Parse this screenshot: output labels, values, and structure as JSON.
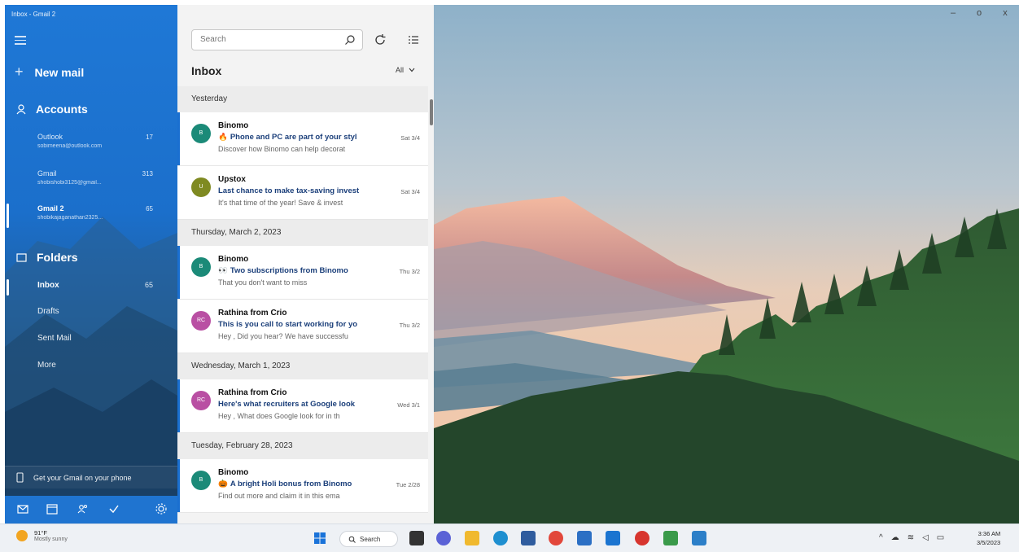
{
  "window": {
    "title": "Inbox - Gmail 2",
    "minimize": "–",
    "maximize": "o",
    "close": "x"
  },
  "sidebar": {
    "new_mail": "New mail",
    "accounts_label": "Accounts",
    "accounts": [
      {
        "name": "Outlook",
        "email": "sobimeena@outlook.com",
        "count": "17"
      },
      {
        "name": "Gmail",
        "email": "shobishobi3125@gmail...",
        "count": "313"
      },
      {
        "name": "Gmail 2",
        "email": "shobikajaganathan2325...",
        "count": "65"
      }
    ],
    "folders_label": "Folders",
    "folders": [
      {
        "label": "Inbox",
        "count": "65"
      },
      {
        "label": "Drafts",
        "count": ""
      },
      {
        "label": "Sent Mail",
        "count": ""
      },
      {
        "label": "More",
        "count": ""
      }
    ],
    "get_phone": "Get your Gmail on your phone"
  },
  "list": {
    "search_placeholder": "Search",
    "title": "Inbox",
    "filter": "All",
    "groups": [
      {
        "header": "Yesterday",
        "messages": [
          {
            "initials": "B",
            "color": "#1b8a78",
            "sender": "Binomo",
            "emoji": "🔥",
            "subject": "Phone and PC are part of your styl",
            "date": "Sat 3/4",
            "preview": "Discover how Binomo can help decorat"
          },
          {
            "initials": "U",
            "color": "#7f8a22",
            "sender": "Upstox",
            "emoji": "",
            "subject": "Last chance to make tax-saving invest",
            "date": "Sat 3/4",
            "preview": "It's that time of the year! Save & invest"
          }
        ]
      },
      {
        "header": "Thursday, March 2, 2023",
        "messages": [
          {
            "initials": "B",
            "color": "#1b8a78",
            "sender": "Binomo",
            "emoji": "👀",
            "subject": "Two subscriptions from Binomo",
            "date": "Thu 3/2",
            "preview": "That you don't want to miss"
          },
          {
            "initials": "RC",
            "color": "#b94fa3",
            "sender": "Rathina from Crio",
            "emoji": "",
            "subject": "This is you call to start working for yo",
            "date": "Thu 3/2",
            "preview": "Hey , Did you hear? We have successfu"
          }
        ]
      },
      {
        "header": "Wednesday, March 1, 2023",
        "messages": [
          {
            "initials": "RC",
            "color": "#b94fa3",
            "sender": "Rathina from Crio",
            "emoji": "",
            "subject": "Here's what recruiters at Google look",
            "date": "Wed 3/1",
            "preview": "Hey , What does Google look for in th"
          }
        ]
      },
      {
        "header": "Tuesday, February 28, 2023",
        "messages": [
          {
            "initials": "B",
            "color": "#1b8a78",
            "sender": "Binomo",
            "emoji": "🎃",
            "subject": "A bright Holi bonus from Binomo",
            "date": "Tue 2/28",
            "preview": "Find out more and claim it in this ema"
          }
        ]
      }
    ]
  },
  "taskbar": {
    "weather_temp": "91°F",
    "weather_desc": "Mostly sunny",
    "search": "Search",
    "time": "3:36 AM",
    "date": "3/5/2023"
  },
  "colors": {
    "accent": "#1a6fd0",
    "sidebar": "#1f78d6"
  }
}
